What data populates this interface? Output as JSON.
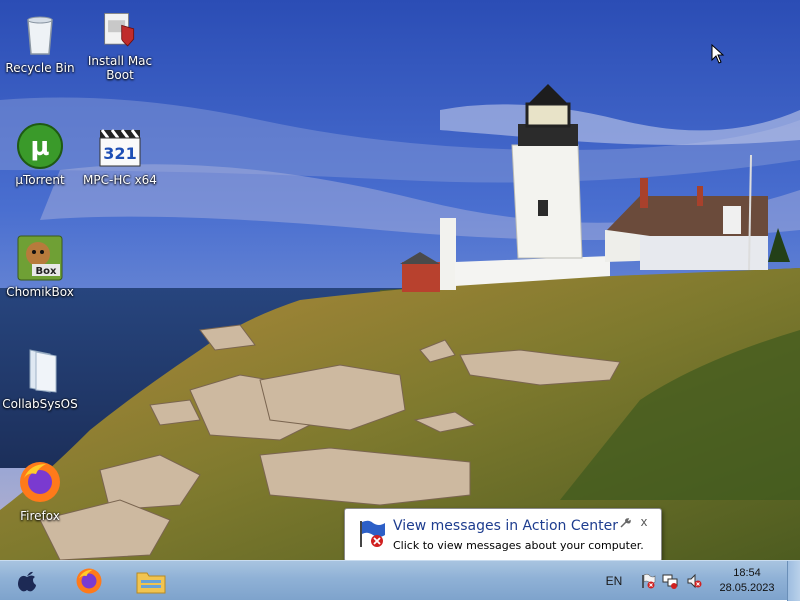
{
  "desktop": {
    "icons": [
      {
        "label": "Recycle Bin",
        "icon": "recycle-bin-icon"
      },
      {
        "label": "Install Mac\nBoot",
        "icon": "installer-icon"
      },
      {
        "label": "µTorrent",
        "icon": "utorrent-icon"
      },
      {
        "label": "MPC-HC x64",
        "icon": "mpc-hc-icon"
      },
      {
        "label": "ChomikBox",
        "icon": "chomikbox-icon"
      },
      {
        "label": "CollabSysOS",
        "icon": "folder-icon"
      },
      {
        "label": "Firefox",
        "icon": "firefox-icon"
      }
    ],
    "mpc_badge": "321",
    "chomik_badge": "Box",
    "utorrent_glyph": "µ"
  },
  "notification": {
    "title": "View messages in Action Center",
    "message": "Click to view messages about your computer.",
    "close_glyph": "x"
  },
  "taskbar": {
    "buttons": [
      {
        "icon": "apple-start-icon"
      },
      {
        "icon": "firefox-icon"
      },
      {
        "icon": "file-explorer-icon"
      }
    ],
    "tray": {
      "language": "EN",
      "icons": [
        "action-center-flag-icon",
        "network-icon",
        "volume-muted-icon"
      ]
    },
    "clock": {
      "time": "18:54",
      "date": "28.05.2023"
    }
  },
  "colors": {
    "taskbar": "#8fb1d6",
    "notification_title": "#1e3d8f"
  }
}
